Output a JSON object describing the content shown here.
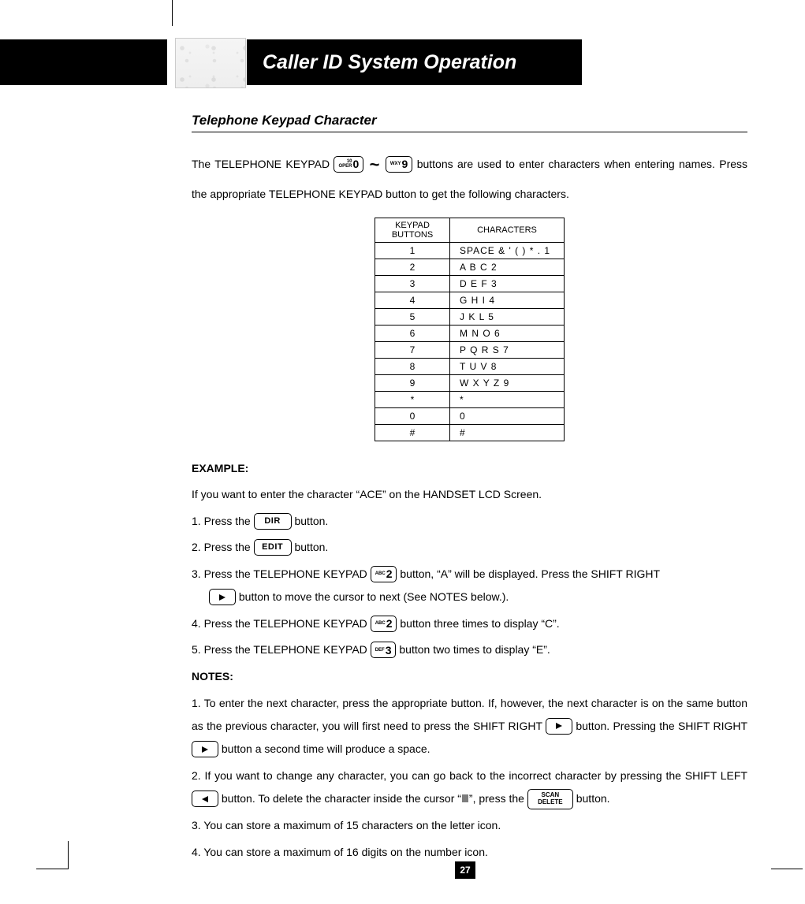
{
  "header": {
    "title": "Caller ID System Operation"
  },
  "section_title": "Telephone Keypad Character",
  "intro": {
    "p1a": "The TELEPHONE KEYPAD ",
    "key0_sup1": "10",
    "key0_sup2": "OPER",
    "key0_big": "0",
    "tilde": "~",
    "key9_sup": "WXY",
    "key9_big": "9",
    "p1b": " buttons are used to enter characters when entering names. Press the appropriate TELEPHONE KEYPAD button to get the following characters."
  },
  "table": {
    "head_a": "KEYPAD BUTTONS",
    "head_b": "CHARACTERS",
    "rows": [
      {
        "k": "1",
        "c": "SPACE & ' ( ) * . 1"
      },
      {
        "k": "2",
        "c": "A B C 2"
      },
      {
        "k": "3",
        "c": "D E F 3"
      },
      {
        "k": "4",
        "c": "G H I 4"
      },
      {
        "k": "5",
        "c": "J K L 5"
      },
      {
        "k": "6",
        "c": "M N O 6"
      },
      {
        "k": "7",
        "c": "P Q R S 7"
      },
      {
        "k": "8",
        "c": "T U V 8"
      },
      {
        "k": "9",
        "c": "W X Y Z 9"
      },
      {
        "k": "*",
        "c": "*"
      },
      {
        "k": "0",
        "c": "0"
      },
      {
        "k": "#",
        "c": "#"
      }
    ]
  },
  "example": {
    "label": "EXAMPLE:",
    "intro": "If you want to enter the character “ACE” on the HANDSET LCD Screen.",
    "steps": {
      "s1a": "1.  Press the ",
      "dir": "DIR",
      "s1b": " button.",
      "s2a": "2.  Press the ",
      "edit": "EDIT",
      "s2b": " button.",
      "s3a": "3.  Press the TELEPHONE KEYPAD ",
      "key2_sup": "ABC",
      "key2_big": "2",
      "s3b": " button, “A” will be displayed. Press the SHIFT RIGHT",
      "s3c": " button to move the cursor to next (See NOTES below.).",
      "s4a": "4.  Press the TELEPHONE KEYPAD ",
      "s4b": " button three times to display “C”.",
      "s5a": "5.  Press the TELEPHONE KEYPAD ",
      "key3_sup": "DEF",
      "key3_big": "3",
      "s5b": " button two times to display “E”."
    }
  },
  "notes": {
    "label": "NOTES:",
    "n1a": "1.  To enter the next character, press the appropriate button. If, however, the next character is on the same button as the previous character, you will first need to press the SHIFT RIGHT ",
    "n1b": " button. Pressing the SHIFT RIGHT ",
    "n1c": " button a second time will produce a space.",
    "n2a": "2.  If you want to change any character, you can go back to the incorrect character by pressing the SHIFT LEFT ",
    "n2b": " button. To delete the character inside the cursor “",
    "n2c": "”, press the ",
    "scan1": "SCAN",
    "scan2": "DELETE",
    "n2d": " button.",
    "n3": "3. You can store a maximum of 15 characters on the letter icon.",
    "n4": "4. You can store a maximum of 16 digits on the number icon."
  },
  "page_number": "27"
}
